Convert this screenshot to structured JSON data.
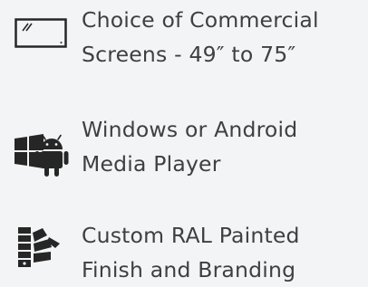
{
  "features": [
    {
      "icon": "monitor-icon",
      "line1": "Choice of Commercial",
      "line2": "Screens - 49″ to 75″"
    },
    {
      "icon": "windows-android-icon",
      "line1": "Windows or Android",
      "line2": "Media Player"
    },
    {
      "icon": "paint-swatch-icon",
      "line1": "Custom RAL Painted",
      "line2": "Finish and Branding"
    }
  ],
  "colors": {
    "background": "#f2f4f5",
    "text": "#3f3f3f",
    "icon": "#262626"
  }
}
